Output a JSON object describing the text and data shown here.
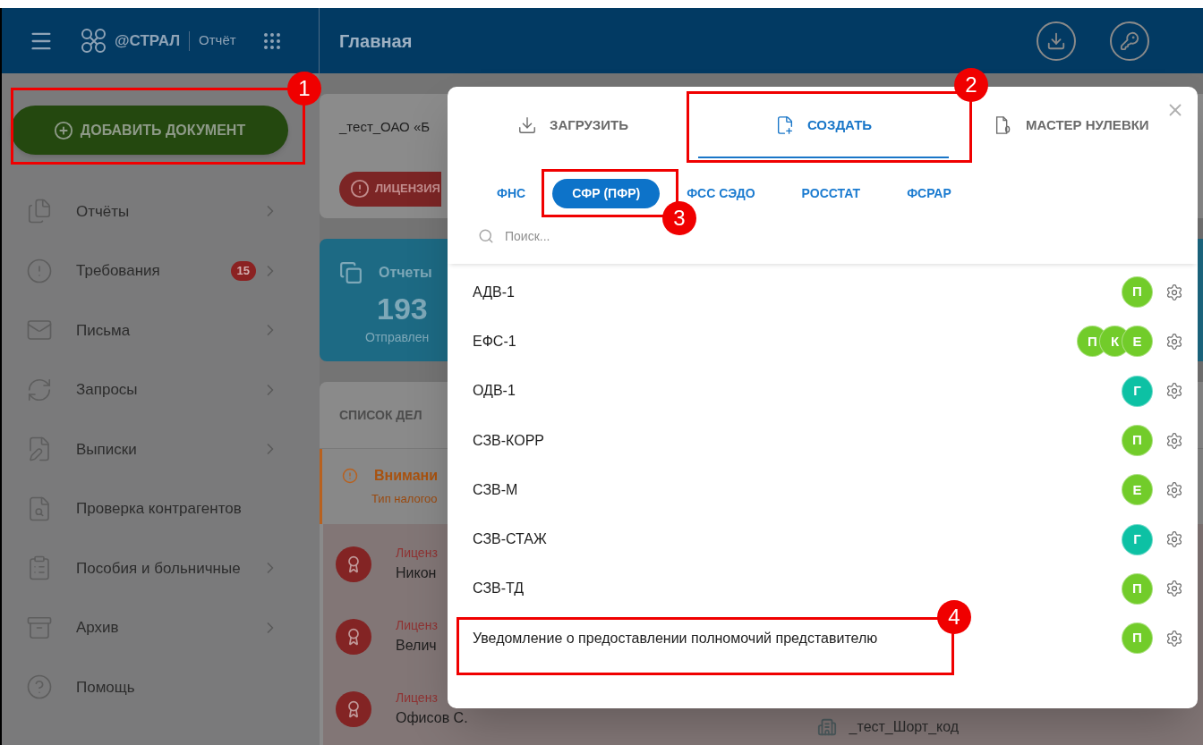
{
  "header": {
    "brand": "@СТРАЛ",
    "product": "Отчёт",
    "title": "Главная"
  },
  "sidebar": {
    "add_button": "ДОБАВИТЬ ДОКУМЕНТ",
    "items": [
      {
        "label": "Отчёты",
        "submenu": true
      },
      {
        "label": "Требования",
        "submenu": true,
        "badge": "15"
      },
      {
        "label": "Письма",
        "submenu": true
      },
      {
        "label": "Запросы",
        "submenu": true
      },
      {
        "label": "Выписки",
        "submenu": true
      },
      {
        "label": "Проверка контрагентов",
        "submenu": false
      },
      {
        "label": "Пособия и больничные",
        "submenu": true
      },
      {
        "label": "Архив",
        "submenu": true
      },
      {
        "label": "Помощь",
        "submenu": false
      }
    ]
  },
  "main": {
    "company_card": {
      "name": "_тест_ОАО «Б",
      "license": "ЛИЦЕНЗИЯ"
    },
    "reports_card": {
      "title": "Отчеты",
      "count": "193",
      "caption": "Отправлен"
    },
    "tasks": {
      "title": "СПИСОК ДЕЛ",
      "alert": {
        "title": "Внимани",
        "text": "Тип налогоо"
      },
      "items": [
        {
          "label": "Лиценз",
          "name": "Никон"
        },
        {
          "label": "Лиценз",
          "name": "Велич"
        },
        {
          "label": "Лиценз",
          "name": "Офисов С."
        }
      ],
      "organization": "_тест_Шорт_код"
    }
  },
  "modal": {
    "tabs": [
      {
        "label": "ЗАГРУЗИТЬ",
        "selected": false
      },
      {
        "label": "СОЗДАТЬ",
        "selected": true
      },
      {
        "label": "МАСТЕР НУЛЕВКИ",
        "selected": false
      }
    ],
    "agencies": [
      {
        "label": "ФНС",
        "selected": false
      },
      {
        "label": "СФР (ПФР)",
        "selected": true
      },
      {
        "label": "ФСС СЭДО",
        "selected": false
      },
      {
        "label": "РОССТАТ",
        "selected": false
      },
      {
        "label": "ФСРАР",
        "selected": false
      }
    ],
    "search": {
      "placeholder": "Поиск..."
    },
    "forms": [
      {
        "name": "АДВ-1",
        "badges": [
          {
            "letter": "П",
            "color": "#72cc2a"
          }
        ]
      },
      {
        "name": "ЕФС-1",
        "badges": [
          {
            "letter": "П",
            "color": "#72cc2a"
          },
          {
            "letter": "К",
            "color": "#72cc2a"
          },
          {
            "letter": "Е",
            "color": "#72cc2a"
          }
        ]
      },
      {
        "name": "ОДВ-1",
        "badges": [
          {
            "letter": "Г",
            "color": "#0dc1a4"
          }
        ]
      },
      {
        "name": "СЗВ-КОРР",
        "badges": [
          {
            "letter": "П",
            "color": "#72cc2a"
          }
        ]
      },
      {
        "name": "СЗВ-М",
        "badges": [
          {
            "letter": "Е",
            "color": "#72cc2a"
          }
        ]
      },
      {
        "name": "СЗВ-СТАЖ",
        "badges": [
          {
            "letter": "Г",
            "color": "#0dc1a4"
          }
        ]
      },
      {
        "name": "СЗВ-ТД",
        "badges": [
          {
            "letter": "П",
            "color": "#72cc2a"
          }
        ]
      },
      {
        "name": "Уведомление о предоставлении полномочий представителю",
        "badges": [
          {
            "letter": "П",
            "color": "#72cc2a"
          }
        ]
      }
    ]
  },
  "annotations": [
    {
      "number": "1"
    },
    {
      "number": "2"
    },
    {
      "number": "3"
    },
    {
      "number": "4"
    }
  ]
}
